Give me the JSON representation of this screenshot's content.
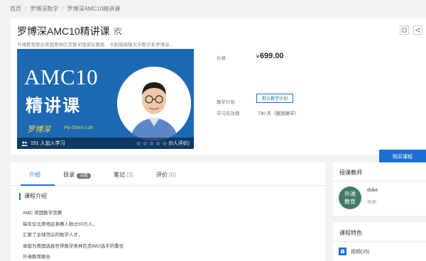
{
  "breadcrumb": {
    "items": [
      "首页",
      "罗博深数学",
      "罗博深AMC10精讲课"
    ]
  },
  "course": {
    "title": "罗博深AMC10精讲课",
    "subtitle": "外滩教育联合美国奥林匹克数学国家队教练、卡耐基梅隆大学数学系罗博深..."
  },
  "banner": {
    "heading": "AMC10",
    "heading_zh": "精讲课",
    "signature": "罗博深",
    "author": "Po-Shen Loh",
    "learners": "151 人加入学习",
    "rating_text": "(0人评价)",
    "rating_value": 0,
    "rating_max": 5
  },
  "info": {
    "price_label": "价格",
    "currency": "¥",
    "price": "699.00",
    "plan_label": "教学计划",
    "plan_button": "默认教学计划",
    "period_label": "学习有效期",
    "period_value": "730 天（随到随学）"
  },
  "actions": {
    "buy": "购买课程"
  },
  "tabs": [
    {
      "label": "介绍"
    },
    {
      "label": "目录",
      "badge": "试看"
    },
    {
      "label": "笔记",
      "count": "(3)"
    },
    {
      "label": "评价",
      "count": "(0)"
    }
  ],
  "intro": {
    "heading": "课程介绍",
    "lines": [
      "AMC 美国数学竞赛",
      "每年仅北美地区参赛人数过30万人，",
      "汇聚了全球顶尖的数学人才，",
      "承担为美国选拔世界数学奥林匹克IMO选手的重任",
      "外滩教育联合"
    ]
  },
  "teacher": {
    "title": "授课教师",
    "avatar_text_top": "外滩",
    "avatar_text_bottom": "教育",
    "name": "duke",
    "role": "导师"
  },
  "features": {
    "title": "课程特色",
    "video": "视频(25)"
  },
  "colors": {
    "accent": "#1d6fd6",
    "banner": "#1d69b3",
    "signature": "#f2d64b"
  }
}
